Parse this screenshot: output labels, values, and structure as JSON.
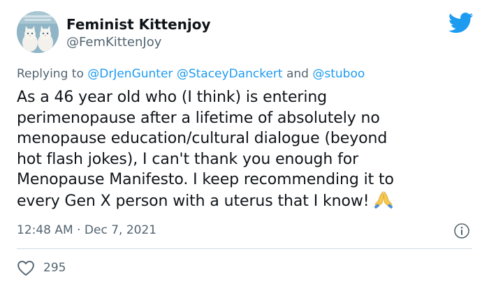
{
  "author": {
    "display_name": "Feminist Kittenjoy",
    "handle": "@FemKittenJoy",
    "avatar_icon": "two-white-kittens-avatar"
  },
  "platform_icon": "twitter-bird-icon",
  "reply": {
    "prefix": "Replying to",
    "mention_1": "@DrJenGunter",
    "mention_2": "@StaceyDanckert",
    "conjunction": "and",
    "mention_3": "@stuboo"
  },
  "tweet": {
    "lines": [
      "As a 46 year old who (I think) is entering",
      "perimenopause after a lifetime of absolutely no",
      "menopause education/cultural dialogue (beyond",
      "hot flash jokes), I can't thank you enough for",
      "Menopause Manifesto. I keep recommending it to",
      "every Gen X person with a uterus that I know!"
    ],
    "emoji": "folded-hands-emoji"
  },
  "meta": {
    "time": "12:48 AM",
    "separator": "·",
    "date": "Dec 7, 2021",
    "info_icon": "info-icon"
  },
  "engagement": {
    "like_icon": "heart-outline-icon",
    "likes": "295"
  },
  "colors": {
    "accent": "#1d9bf0",
    "text": "#0f1419",
    "secondary": "#536471",
    "divider": "#cfd9de"
  }
}
